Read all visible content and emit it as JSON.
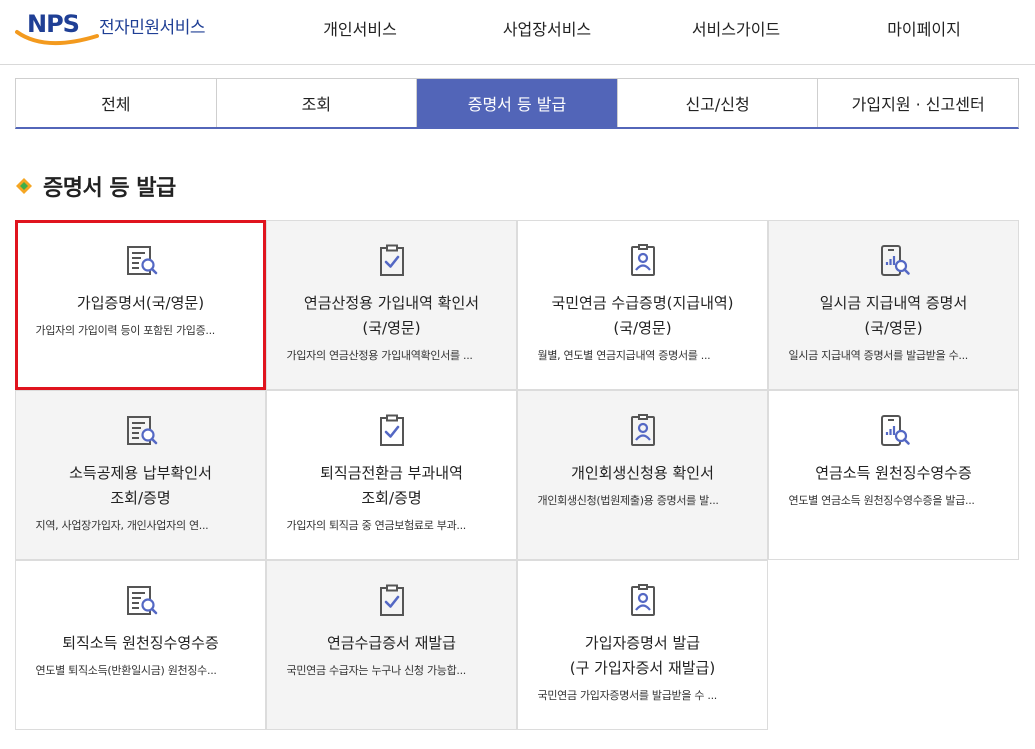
{
  "header": {
    "logo_letters": "NPS",
    "logo_text": "전자민원서비스",
    "nav": [
      "개인서비스",
      "사업장서비스",
      "서비스가이드",
      "마이페이지"
    ]
  },
  "tabs": [
    {
      "label": "전체",
      "active": false
    },
    {
      "label": "조회",
      "active": false
    },
    {
      "label": "증명서 등 발급",
      "active": true
    },
    {
      "label": "신고/신청",
      "active": false
    },
    {
      "label": "가입지원 · 신고센터",
      "active": false
    }
  ],
  "section": {
    "title": "증명서 등 발급"
  },
  "colors": {
    "accent": "#5265b8",
    "selected_border": "#e0141e",
    "icon_stroke": "#555555",
    "icon_accent": "#5468c4"
  },
  "cards": [
    {
      "title": "가입증명서(국/영문)",
      "desc": "가입자의 가입이력 등이 포함된 가입증...",
      "icon": "document-search-icon",
      "selected": true
    },
    {
      "title": "연금산정용 가입내역 확인서\n(국/영문)",
      "desc": "가입자의 연금산정용 가입내역확인서를 ...",
      "icon": "clipboard-check-icon",
      "selected": false
    },
    {
      "title": "국민연금 수급증명(지급내역)\n(국/영문)",
      "desc": "월별, 연도별 연금지급내역 증명서를 ...",
      "icon": "person-badge-icon",
      "selected": false
    },
    {
      "title": "일시금 지급내역 증명서\n(국/영문)",
      "desc": "일시금 지급내역 증명서를 발급받을 수...",
      "icon": "device-chart-search-icon",
      "selected": false
    },
    {
      "title": "소득공제용 납부확인서\n조회/증명",
      "desc": "지역, 사업장가입자, 개인사업자의 연...",
      "icon": "document-search-icon",
      "selected": false
    },
    {
      "title": "퇴직금전환금 부과내역\n조회/증명",
      "desc": "가입자의 퇴직금 중 연금보험료로 부과...",
      "icon": "clipboard-check-icon",
      "selected": false
    },
    {
      "title": "개인회생신청용 확인서",
      "desc": "개인회생신청(법원제출)용 증명서를 발...",
      "icon": "person-badge-icon",
      "selected": false
    },
    {
      "title": "연금소득 원천징수영수증",
      "desc": "연도별 연금소득 원천징수영수증을 발급...",
      "icon": "device-chart-search-icon",
      "selected": false
    },
    {
      "title": "퇴직소득 원천징수영수증",
      "desc": "연도별 퇴직소득(반환일시금) 원천징수...",
      "icon": "document-search-icon",
      "selected": false
    },
    {
      "title": "연금수급증서 재발급",
      "desc": "국민연금 수급자는 누구나 신청 가능합...",
      "icon": "clipboard-check-icon",
      "selected": false
    },
    {
      "title": "가입자증명서 발급\n(구 가입자증서 재발급)",
      "desc": "국민연금 가입자증명서를 발급받을 수 ...",
      "icon": "person-badge-icon",
      "selected": false
    }
  ]
}
